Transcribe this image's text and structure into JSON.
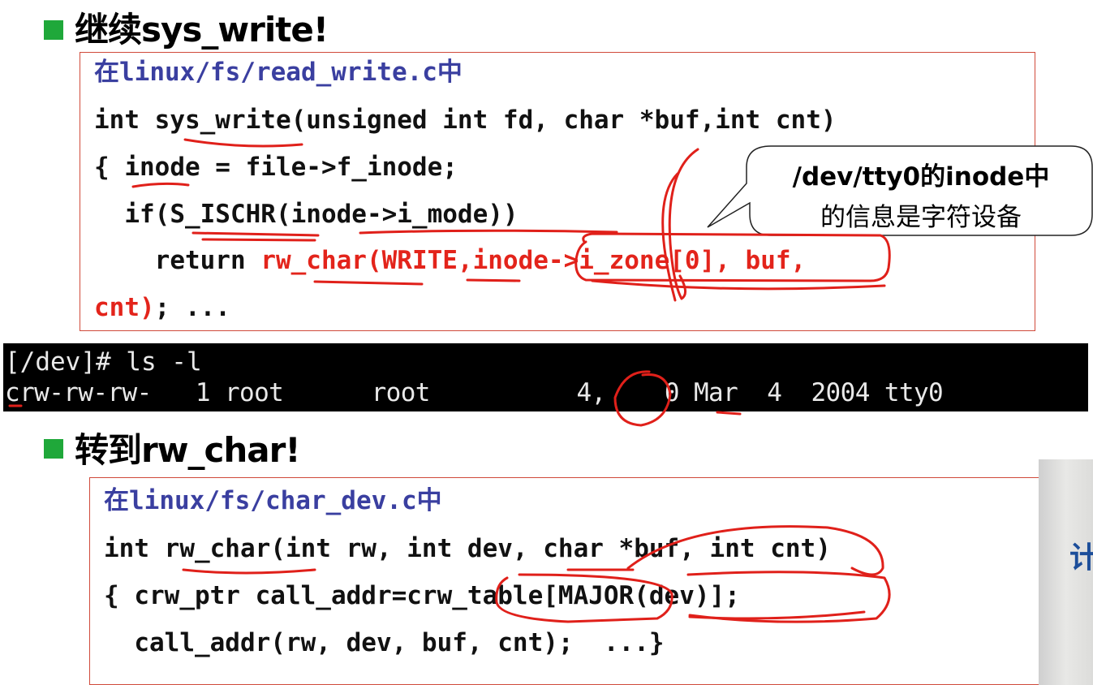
{
  "section1": {
    "heading": "继续sys_write!",
    "code": {
      "path_line": "在linux/fs/read_write.c中",
      "line2": "int sys_write(unsigned int fd, char *buf,int cnt)",
      "line3": "{ inode = file->f_inode;",
      "line4": "  if(S_ISCHR(inode->i_mode))",
      "line5_prefix": "    return ",
      "line5_red": "rw_char(WRITE,inode->i_zone[0], buf,",
      "line6_red": "cnt)",
      "line6_rest": "; ..."
    },
    "callout": {
      "line1": "/dev/tty0的inode中",
      "line2": "的信息是字符设备"
    }
  },
  "terminal": {
    "line1": "[/dev]# ls -l",
    "line2": "crw-rw-rw-   1 root      root          4,    0 Mar  4  2004 tty0"
  },
  "section2": {
    "heading": "转到rw_char!",
    "code": {
      "path_line": "在linux/fs/char_dev.c中",
      "line2": "int rw_char(int rw, int dev, char *buf, int cnt)",
      "line3": "{ crw_ptr call_addr=crw_table[MAJOR(dev)];",
      "line4": "  call_addr(rw, dev, buf, cnt);  ...}"
    }
  },
  "side": {
    "glyph": "计"
  },
  "colors": {
    "accent_green": "#1fa83a",
    "code_red": "#e3241b",
    "path_blue": "#3a3fa0",
    "box_border": "#d04a3a",
    "ink_red": "#e0201a"
  }
}
